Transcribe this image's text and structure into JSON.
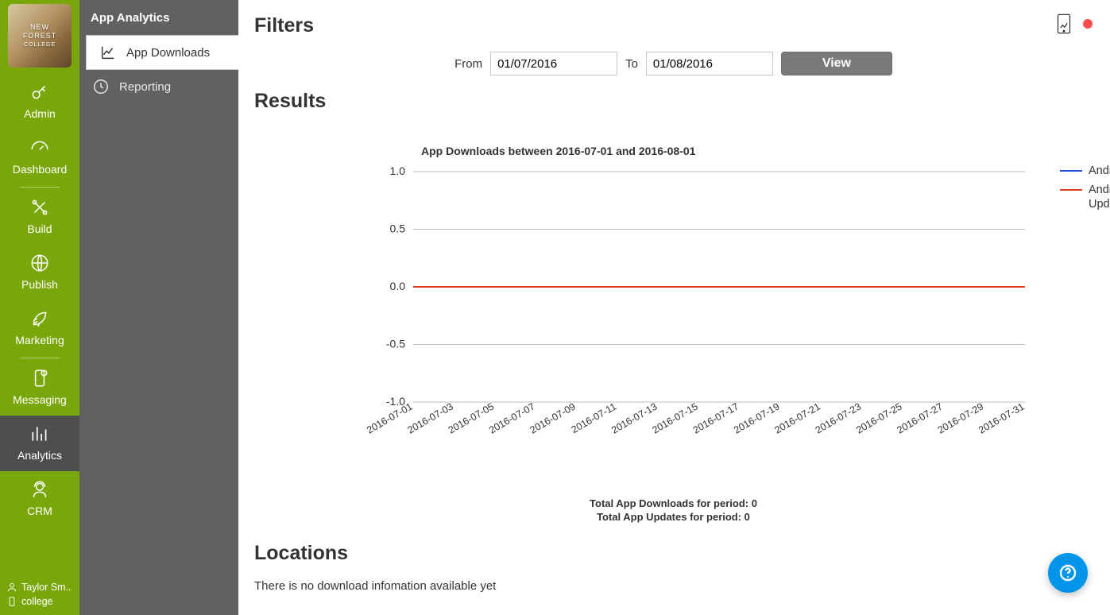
{
  "brand": {
    "line1": "NEW FOREST",
    "line2": "COLLEGE"
  },
  "nav": {
    "items": [
      {
        "label": "Admin"
      },
      {
        "label": "Dashboard"
      },
      {
        "label": "Build"
      },
      {
        "label": "Publish"
      },
      {
        "label": "Marketing"
      },
      {
        "label": "Messaging"
      },
      {
        "label": "Analytics"
      },
      {
        "label": "CRM"
      }
    ],
    "footer_user": "Taylor Sm..",
    "footer_app": "college"
  },
  "subnav": {
    "header": "App Analytics",
    "items": [
      {
        "label": "App Downloads"
      },
      {
        "label": "Reporting"
      }
    ]
  },
  "filters": {
    "heading": "Filters",
    "from_label": "From",
    "from_value": "01/07/2016",
    "to_label": "To",
    "to_value": "01/08/2016",
    "view_button": "View"
  },
  "results": {
    "heading": "Results",
    "totals_downloads": "Total App Downloads for period: 0",
    "totals_updates": "Total App Updates for period: 0"
  },
  "locations": {
    "heading": "Locations",
    "empty": "There is no download infomation available yet"
  },
  "chart_data": {
    "type": "line",
    "title": "App Downloads between 2016-07-01 and 2016-08-01",
    "xlabel": "",
    "ylabel": "",
    "ylim": [
      -1.0,
      1.0
    ],
    "yticks": [
      -1.0,
      -0.5,
      0.0,
      0.5,
      1.0
    ],
    "categories": [
      "2016-07-01",
      "2016-07-03",
      "2016-07-05",
      "2016-07-07",
      "2016-07-09",
      "2016-07-11",
      "2016-07-13",
      "2016-07-15",
      "2016-07-17",
      "2016-07-19",
      "2016-07-21",
      "2016-07-23",
      "2016-07-25",
      "2016-07-27",
      "2016-07-29",
      "2016-07-31"
    ],
    "series": [
      {
        "name": "Android",
        "color": "#1f4fd6",
        "values": [
          0,
          0,
          0,
          0,
          0,
          0,
          0,
          0,
          0,
          0,
          0,
          0,
          0,
          0,
          0,
          0
        ]
      },
      {
        "name": "Android Updates",
        "color": "#e23b1a",
        "values": [
          0,
          0,
          0,
          0,
          0,
          0,
          0,
          0,
          0,
          0,
          0,
          0,
          0,
          0,
          0,
          0
        ]
      }
    ]
  }
}
